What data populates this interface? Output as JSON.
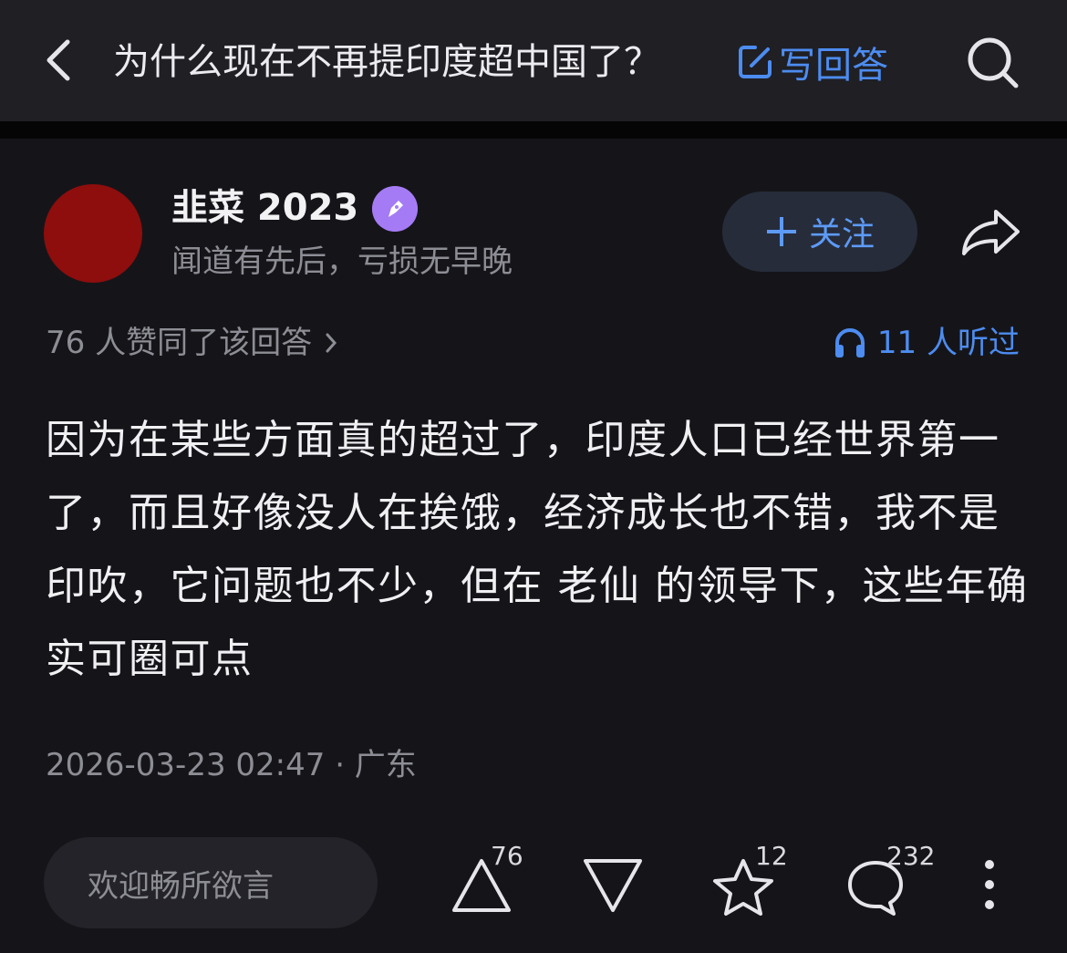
{
  "header": {
    "back_icon": "chevron-left-icon",
    "question_title": "为什么现在不再提印度超中国了？",
    "write_answer_label": "写回答",
    "write_answer_icon": "edit-icon",
    "search_icon": "search-icon",
    "accent_color": "#4d8cf0"
  },
  "author": {
    "name": "韭菜 2023",
    "badge_icon": "pen-badge-icon",
    "bio": "闻道有先后，亏损无早晚",
    "follow_label": "关注",
    "avatar_color": "#8e0d0d"
  },
  "stats": {
    "likes_text": "76 人赞同了该回答",
    "listened_text": "11 人听过"
  },
  "answer": {
    "body": "因为在某些方面真的超过了，印度人口已经世界第一了，而且好像没人在挨饿，经济成长也不错，我不是印吹，它问题也不少，但在 老仙 的领导下，这些年确实可圈可点"
  },
  "meta": {
    "datetime_location": "2026-03-23 02:47 · 广东"
  },
  "bottom_bar": {
    "comment_placeholder": "欢迎畅所欲言",
    "upvote_count": "76",
    "favorite_count": "12",
    "comment_count": "232"
  }
}
